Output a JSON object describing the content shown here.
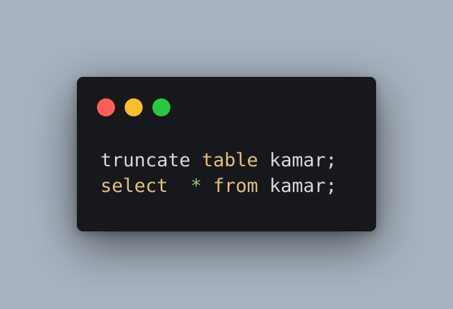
{
  "colors": {
    "background": "#a8b3bf",
    "window": "#17181b",
    "plain": "#d8d8d8",
    "keyword": "#e5c07b",
    "operator": "#98c379",
    "close_dot": "#ff5f56",
    "minimize_dot": "#ffbd2e",
    "maximize_dot": "#27c93f"
  },
  "window_controls": {
    "close_icon": "circle-red",
    "minimize_icon": "circle-yellow",
    "maximize_icon": "circle-green"
  },
  "code": {
    "lines": [
      {
        "tokens": [
          {
            "text": "truncate ",
            "type": "plain"
          },
          {
            "text": "table",
            "type": "keyword"
          },
          {
            "text": " kamar;",
            "type": "plain"
          }
        ]
      },
      {
        "tokens": [
          {
            "text": "select",
            "type": "keyword"
          },
          {
            "text": "  ",
            "type": "plain"
          },
          {
            "text": "*",
            "type": "operator"
          },
          {
            "text": " ",
            "type": "plain"
          },
          {
            "text": "from",
            "type": "keyword"
          },
          {
            "text": " kamar;",
            "type": "plain"
          }
        ]
      }
    ]
  }
}
